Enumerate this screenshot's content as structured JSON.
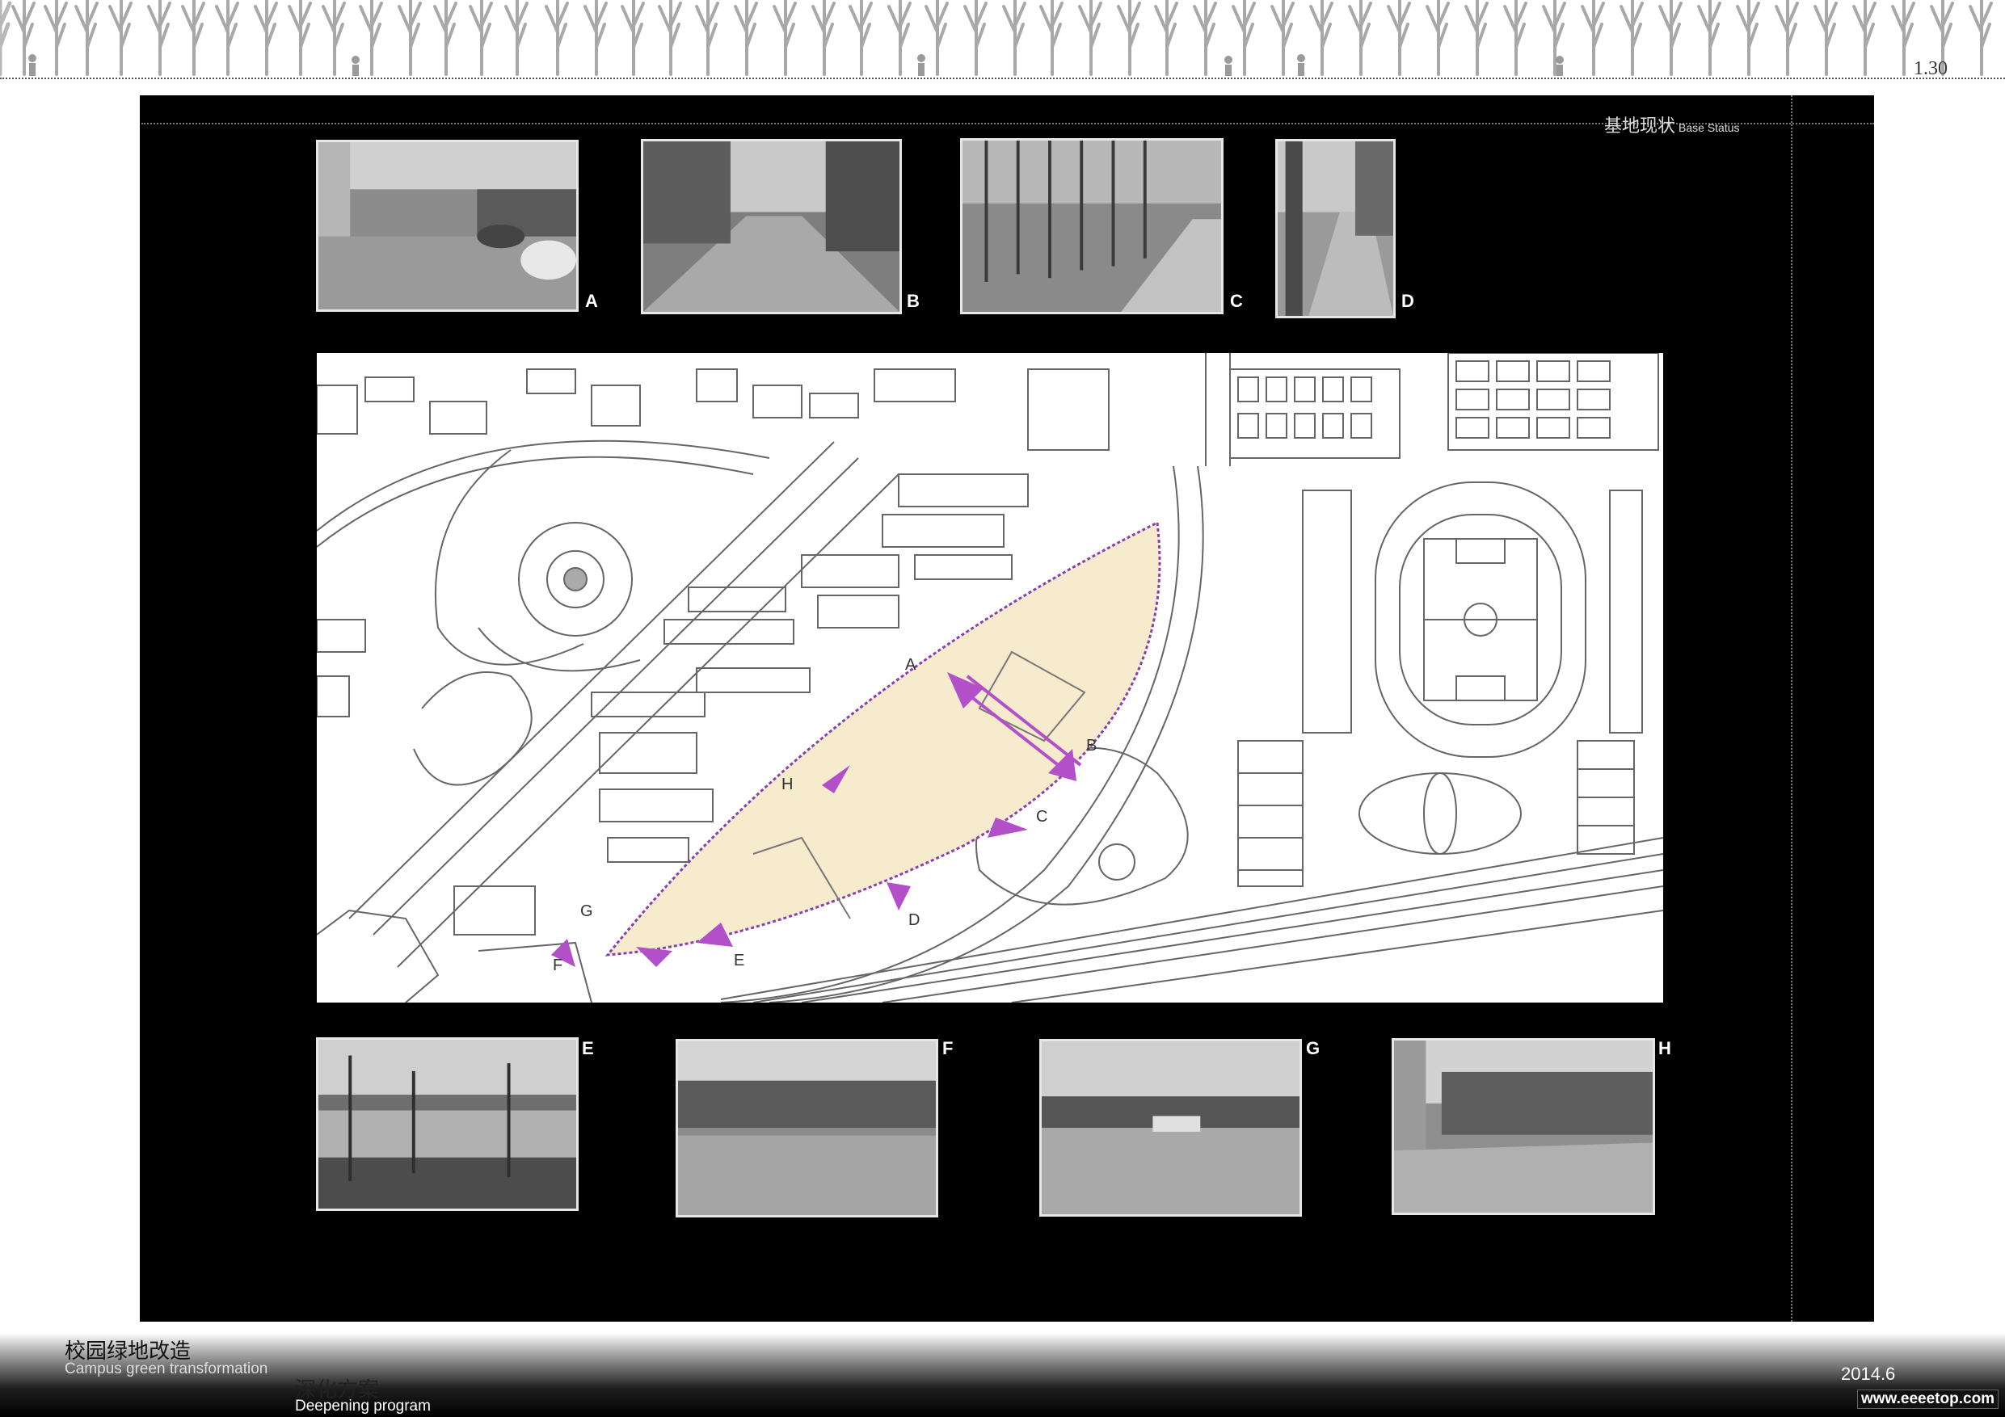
{
  "header": {
    "page_number": "1.30"
  },
  "section": {
    "title_cn": "基地现状",
    "title_en": "Base Status"
  },
  "photos": {
    "top": [
      {
        "letter": "A"
      },
      {
        "letter": "B"
      },
      {
        "letter": "C"
      },
      {
        "letter": "D"
      }
    ],
    "bottom": [
      {
        "letter": "E"
      },
      {
        "letter": "F"
      },
      {
        "letter": "G"
      },
      {
        "letter": "H"
      }
    ]
  },
  "map": {
    "viewpoints": [
      "A",
      "B",
      "C",
      "D",
      "E",
      "F",
      "G",
      "H"
    ],
    "colors": {
      "site_fill": "#f6ebcd",
      "site_border": "#8a3fb0",
      "arrow": "#b24fc9"
    }
  },
  "footer": {
    "title_cn": "校园绿地改造",
    "title_en": "Campus green transformation",
    "subtitle_cn": "深化方案",
    "subtitle_en": "Deepening program",
    "date": "2014.6",
    "website": "www.eeeetop.com"
  }
}
